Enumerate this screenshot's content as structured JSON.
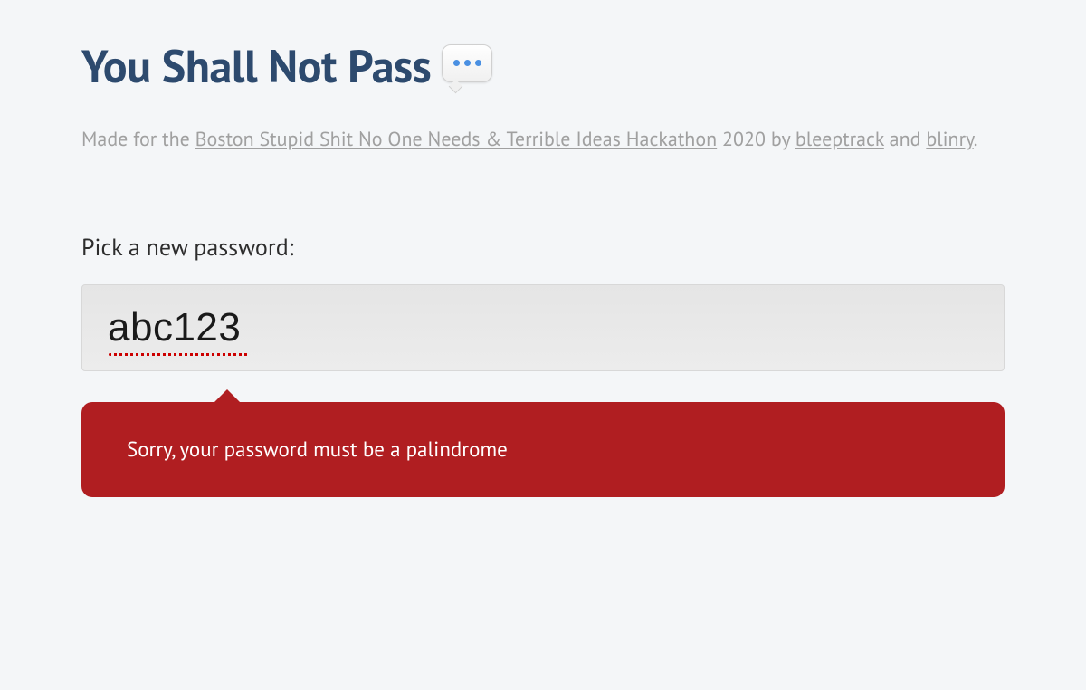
{
  "header": {
    "title": "You Shall Not Pass"
  },
  "credits": {
    "prefix": "Made for the ",
    "link1": "Boston Stupid Shit No One Needs & Terrible Ideas Hackathon",
    "afterLink1": " 2020 by ",
    "link2": "bleeptrack",
    "afterLink2": " and ",
    "link3": "blinry",
    "suffix": "."
  },
  "form": {
    "label": "Pick a new password:",
    "value": "abc123"
  },
  "error": {
    "message": "Sorry, your password must be a palindrome"
  }
}
